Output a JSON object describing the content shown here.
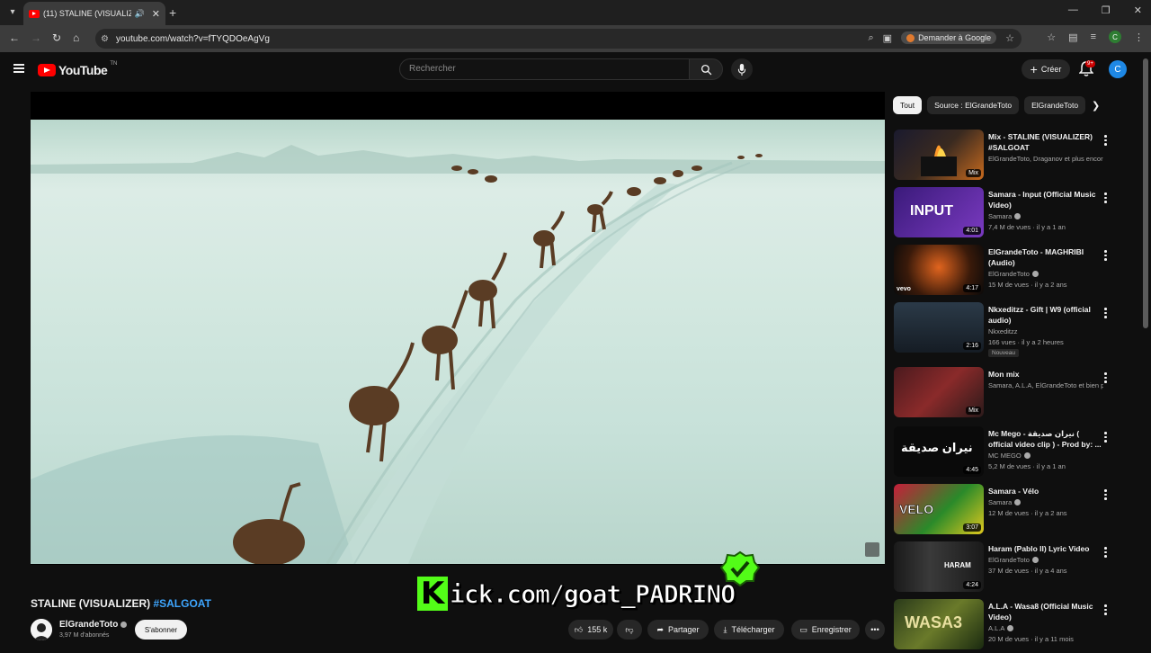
{
  "browser": {
    "tab_title": "(11) STALINE (VISUALIZER) #",
    "url": "youtube.com/watch?v=fTYQDOeAgVg",
    "ask_google": "Demander à Google",
    "profile_initial": "C"
  },
  "header": {
    "logo": "YouTube",
    "logo_tm": "TN",
    "search_placeholder": "Rechercher",
    "create_label": "Créer",
    "notif_count": "9+",
    "avatar_initial": "C"
  },
  "overlay": {
    "kick_k": "K",
    "kick_text": "ick.com/goat_PADRINO"
  },
  "video": {
    "title": "STALINE (VISUALIZER)",
    "hashtag": "#SALGOAT",
    "channel": "ElGrandeToto",
    "subscribers": "3,97 M d'abonnés",
    "subscribe_label": "S'abonner",
    "likes": "155 k",
    "share_label": "Partager",
    "download_label": "Télécharger",
    "save_label": "Enregistrer"
  },
  "sidebar": {
    "chips": [
      "Tout",
      "Source : ElGrandeToto",
      "ElGrandeToto"
    ],
    "items": [
      {
        "title": "Mix - STALINE (VISUALIZER) #SALGOAT",
        "channel": "ElGrandeToto, Draganov et plus encore",
        "meta": "",
        "badge_text": "Mix",
        "verified": false
      },
      {
        "title": "Samara - Input (Official Music Video)",
        "channel": "Samara",
        "meta": "7,4 M de vues · il y a 1 an",
        "badge_text": "4:01",
        "verified": true
      },
      {
        "title": "ElGrandeToto - MAGHRIBI (Audio)",
        "channel": "ElGrandeToto",
        "meta": "15 M de vues · il y a 2 ans",
        "badge_text": "4:17",
        "verified": true
      },
      {
        "title": "Nkxeditzz - Gift | W9 (official audio)",
        "channel": "Nkxeditzz",
        "meta": "166 vues · il y a 2 heures",
        "badge_text": "2:16",
        "verified": false,
        "extra": "Nouveau"
      },
      {
        "title": "Mon mix",
        "channel": "Samara, A.L.A, ElGrandeToto et bien pl...",
        "meta": "",
        "badge_text": "Mix",
        "verified": false
      },
      {
        "title": "Mc Mego - نيران صديقة ( official video clip ) - Prod by: ...",
        "channel": "MC MEGO",
        "meta": "5,2 M de vues · il y a 1 an",
        "badge_text": "4:45",
        "verified": true
      },
      {
        "title": "Samara - Vélo",
        "channel": "Samara",
        "meta": "12 M de vues · il y a 2 ans",
        "badge_text": "3:07",
        "verified": true
      },
      {
        "title": "Haram (Pablo II) Lyric Video",
        "channel": "ElGrandeToto",
        "meta": "37 M de vues · il y a 4 ans",
        "badge_text": "4:24",
        "verified": true
      },
      {
        "title": "A.L.A - Wasa8 (Official Music Video)",
        "channel": "A.L.A",
        "meta": "20 M de vues · il y a 11 mois",
        "badge_text": "",
        "verified": true
      }
    ],
    "thumb_texts": {
      "input": "INPUT",
      "vevo": "vevo",
      "arabic": "نيران صديقة",
      "velo": "VELO",
      "haram": "HARAM",
      "wasa": "WASA3"
    }
  }
}
